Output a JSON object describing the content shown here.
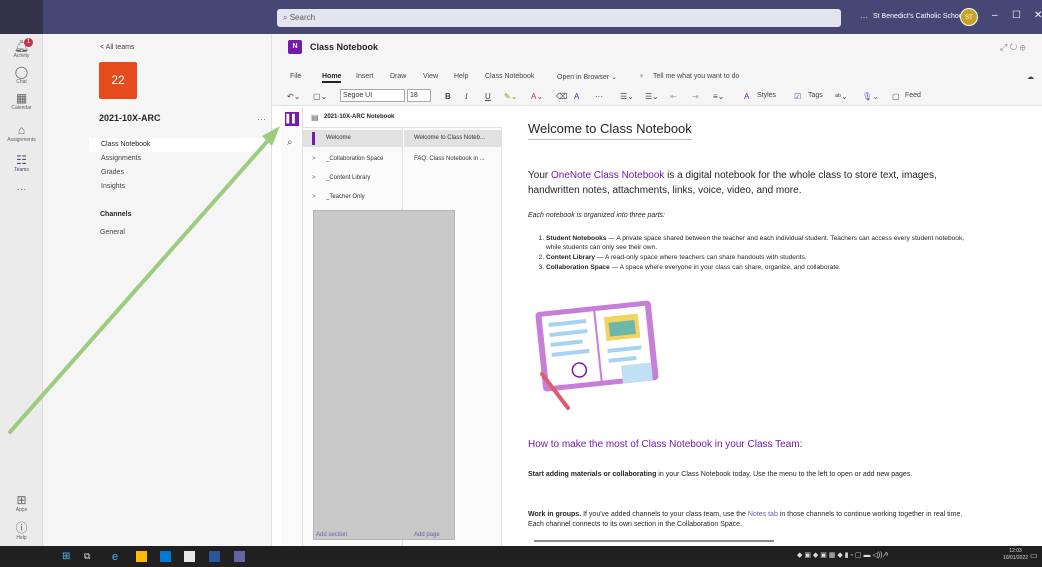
{
  "titlebar": {
    "back_icon": "chevron-left-icon",
    "forward_icon": "chevron-right-icon",
    "search_placeholder": "Search",
    "more": "···",
    "school_name": "St Benedict's Catholic School",
    "avatar_initials": "ST",
    "minimize": "–",
    "maximize": "☐",
    "close": "✕"
  },
  "rail": {
    "activity_badge": "1",
    "items": [
      {
        "label": "Activity",
        "icon": "bell-icon"
      },
      {
        "label": "Chat",
        "icon": "chat-icon"
      },
      {
        "label": "Calendar",
        "icon": "calendar-icon"
      },
      {
        "label": "Assignments",
        "icon": "assignments-icon"
      },
      {
        "label": "Teams",
        "icon": "teams-icon"
      },
      {
        "label": "···",
        "icon": "more-icon"
      },
      {
        "label": "Apps",
        "icon": "apps-icon"
      },
      {
        "label": "Help",
        "icon": "help-icon"
      }
    ]
  },
  "team": {
    "all_teams": "< All teams",
    "tile": "22",
    "name": "2021-10X-ARC",
    "more": "···",
    "tabs": [
      "Class Notebook",
      "Assignments",
      "Grades",
      "Insights"
    ],
    "channels_heading": "Channels",
    "channels": [
      "General"
    ]
  },
  "header": {
    "app_logo": "N",
    "title": "Class Notebook",
    "icons": "⤢ ↻ ⊕"
  },
  "menu": {
    "items": [
      "File",
      "Home",
      "Insert",
      "Draw",
      "View",
      "Help",
      "Class Notebook",
      "Open in Browser ⌄",
      "Tell me what you want to do"
    ],
    "active": "Home"
  },
  "ribbon": {
    "font": "Segoe UI",
    "size": "18",
    "bold": "B",
    "italic": "I",
    "underline": "U",
    "styles": "Styles",
    "tags": "Tags",
    "feed": "Feed"
  },
  "notebook": {
    "name": "2021-10X-ARC Notebook",
    "sections": [
      {
        "label": "Welcome",
        "selected": true
      },
      {
        "label": "_Collaboration Space",
        "selected": false
      },
      {
        "label": "_Content Library",
        "selected": false
      },
      {
        "label": "_Teacher Only",
        "selected": false
      }
    ],
    "pages": [
      {
        "label": "Welcome to Class Noteb...",
        "selected": true
      },
      {
        "label": "FAQ: Class Notebook in ...",
        "selected": false
      }
    ],
    "add_section": "Add section",
    "add_page": "Add page"
  },
  "page": {
    "title": "Welcome to Class Notebook",
    "intro_pre": "Your ",
    "intro_link": "OneNote Class Notebook",
    "intro_post": " is a digital notebook for the whole class to store text, images, handwritten notes, attachments, links, voice, video, and more.",
    "organized": "Each notebook is organized into three parts:",
    "parts": [
      {
        "title": "Student Notebooks",
        "text": " — A private space shared between the teacher and each individual student. Teachers can access every student notebook, while students can only see their own."
      },
      {
        "title": "Content Library",
        "text": " — A read-only space where teachers can share handouts with students."
      },
      {
        "title": "Collaboration Space",
        "text": " — A space where everyone in your class can share, organize, and collaborate."
      }
    ],
    "howto": "How to make the most of Class Notebook in your Class Team:",
    "start_bold": "Start adding materials or collaborating",
    "start_text": " in your Class Notebook today. Use the menu to the left to open or add new pages.",
    "work_bold": "Work in groups.",
    "work_pre": " If you've added channels to your class team, use the ",
    "work_link": "Notes tab",
    "work_post": " in those channels to continue working together in real time. Each channel connects to its own section in the Collaboration Space."
  },
  "taskbar": {
    "time": "12:03",
    "date": "10/01/2022"
  },
  "colors": {
    "teams_purple": "#464775",
    "onenote_purple": "#7719aa",
    "team_tile": "#e64b1e",
    "arrow_green": "#9ccc7e"
  }
}
